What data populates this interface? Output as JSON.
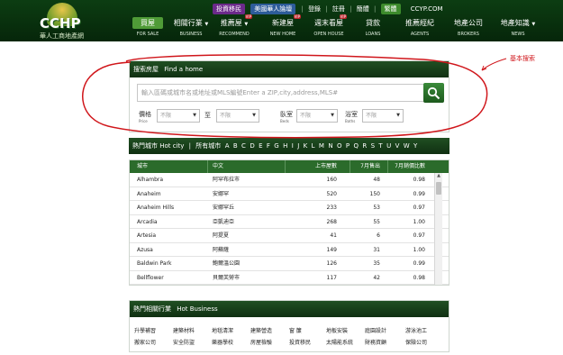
{
  "header": {
    "logo_text": "CCHP",
    "logo_sub": "華人工商地產網",
    "topbar": {
      "invest": "投資移民",
      "forum": "美國華人論壇",
      "login": "登錄",
      "register": "註冊",
      "simplified": "簡體",
      "traditional": "繁體",
      "site": "CCYP.COM"
    },
    "nav": [
      {
        "cn": "買屋",
        "en": "FOR SALE",
        "active": true
      },
      {
        "cn": "相關行業",
        "en": "BUSINESS",
        "dropdown": true
      },
      {
        "cn": "推薦屋",
        "en": "RECOMMEND",
        "dropdown": true,
        "badge": "VIP"
      },
      {
        "cn": "新建屋",
        "en": "NEW HOME",
        "badge": "VIP"
      },
      {
        "cn": "週末看屋",
        "en": "OPEN HOUSE",
        "badge": "VIP"
      },
      {
        "cn": "貸款",
        "en": "LOANS"
      },
      {
        "cn": "推薦經紀",
        "en": "AGENTS"
      },
      {
        "cn": "地產公司",
        "en": "BROKERS"
      },
      {
        "cn": "地產知識",
        "en": "NEWS",
        "dropdown": true
      }
    ]
  },
  "search": {
    "title_cn": "搜索房屋",
    "title_en": "Find a home",
    "placeholder": "輸入區碼或城市名或地址或MLS編號Enter a ZIP,city,address,MLS#",
    "price_label": "價格",
    "price_label_en": "Price",
    "to_label": "至",
    "beds_label": "臥室",
    "beds_label_en": "Beds",
    "baths_label": "浴室",
    "baths_label_en": "Baths",
    "unlimited": "不限"
  },
  "hot_city": {
    "title_cn": "熱門城市",
    "title_en": "Hot city",
    "all_cities": "所有城市",
    "letters": [
      "A",
      "B",
      "C",
      "D",
      "E",
      "F",
      "G",
      "H",
      "I",
      "J",
      "K",
      "L",
      "M",
      "N",
      "O",
      "P",
      "Q",
      "R",
      "S",
      "T",
      "U",
      "V",
      "W",
      "Y"
    ]
  },
  "city_table": {
    "headers": [
      "城市",
      "中文",
      "上市屋數",
      "7月售出",
      "7月銷價比數"
    ],
    "rows": [
      [
        "Alhambra",
        "阿罕布拉市",
        "160",
        "48",
        "0.98"
      ],
      [
        "Anaheim",
        "安娜罕",
        "520",
        "150",
        "0.99"
      ],
      [
        "Anaheim Hills",
        "安娜罕丘",
        "233",
        "53",
        "0.97"
      ],
      [
        "Arcadia",
        "亞凱迪亞",
        "268",
        "55",
        "1.00"
      ],
      [
        "Artesia",
        "阿提夏",
        "41",
        "6",
        "0.97"
      ],
      [
        "Azusa",
        "阿蘇薩",
        "149",
        "31",
        "1.00"
      ],
      [
        "Baldwin Park",
        "鮑爾溫公園",
        "126",
        "35",
        "0.99"
      ],
      [
        "Bellflower",
        "貝爾芙勞市",
        "117",
        "42",
        "0.98"
      ]
    ]
  },
  "business": {
    "title_cn": "熱門相關行業",
    "title_en": "Hot Business",
    "row1": [
      "升學補習",
      "建築材料",
      "地毯清潔",
      "建築營造",
      "窗 簾",
      "地板安裝",
      "庭園設計",
      "游泳池工"
    ],
    "row2": [
      "搬家公司",
      "安全防盜",
      "樂器學校",
      "房屋檢驗",
      "投資移民",
      "太陽能系統",
      "財務資顧",
      "保險公司"
    ]
  },
  "annotation": {
    "note": "基本搜索",
    "color": "#d0161b"
  },
  "colors": {
    "header_bg": "#0c3d12",
    "panel_head_bg": "#204f22",
    "table_head_bg": "#2b6b2b",
    "active_nav": "#4f9b37",
    "search_btn": "#2d7a2d"
  }
}
